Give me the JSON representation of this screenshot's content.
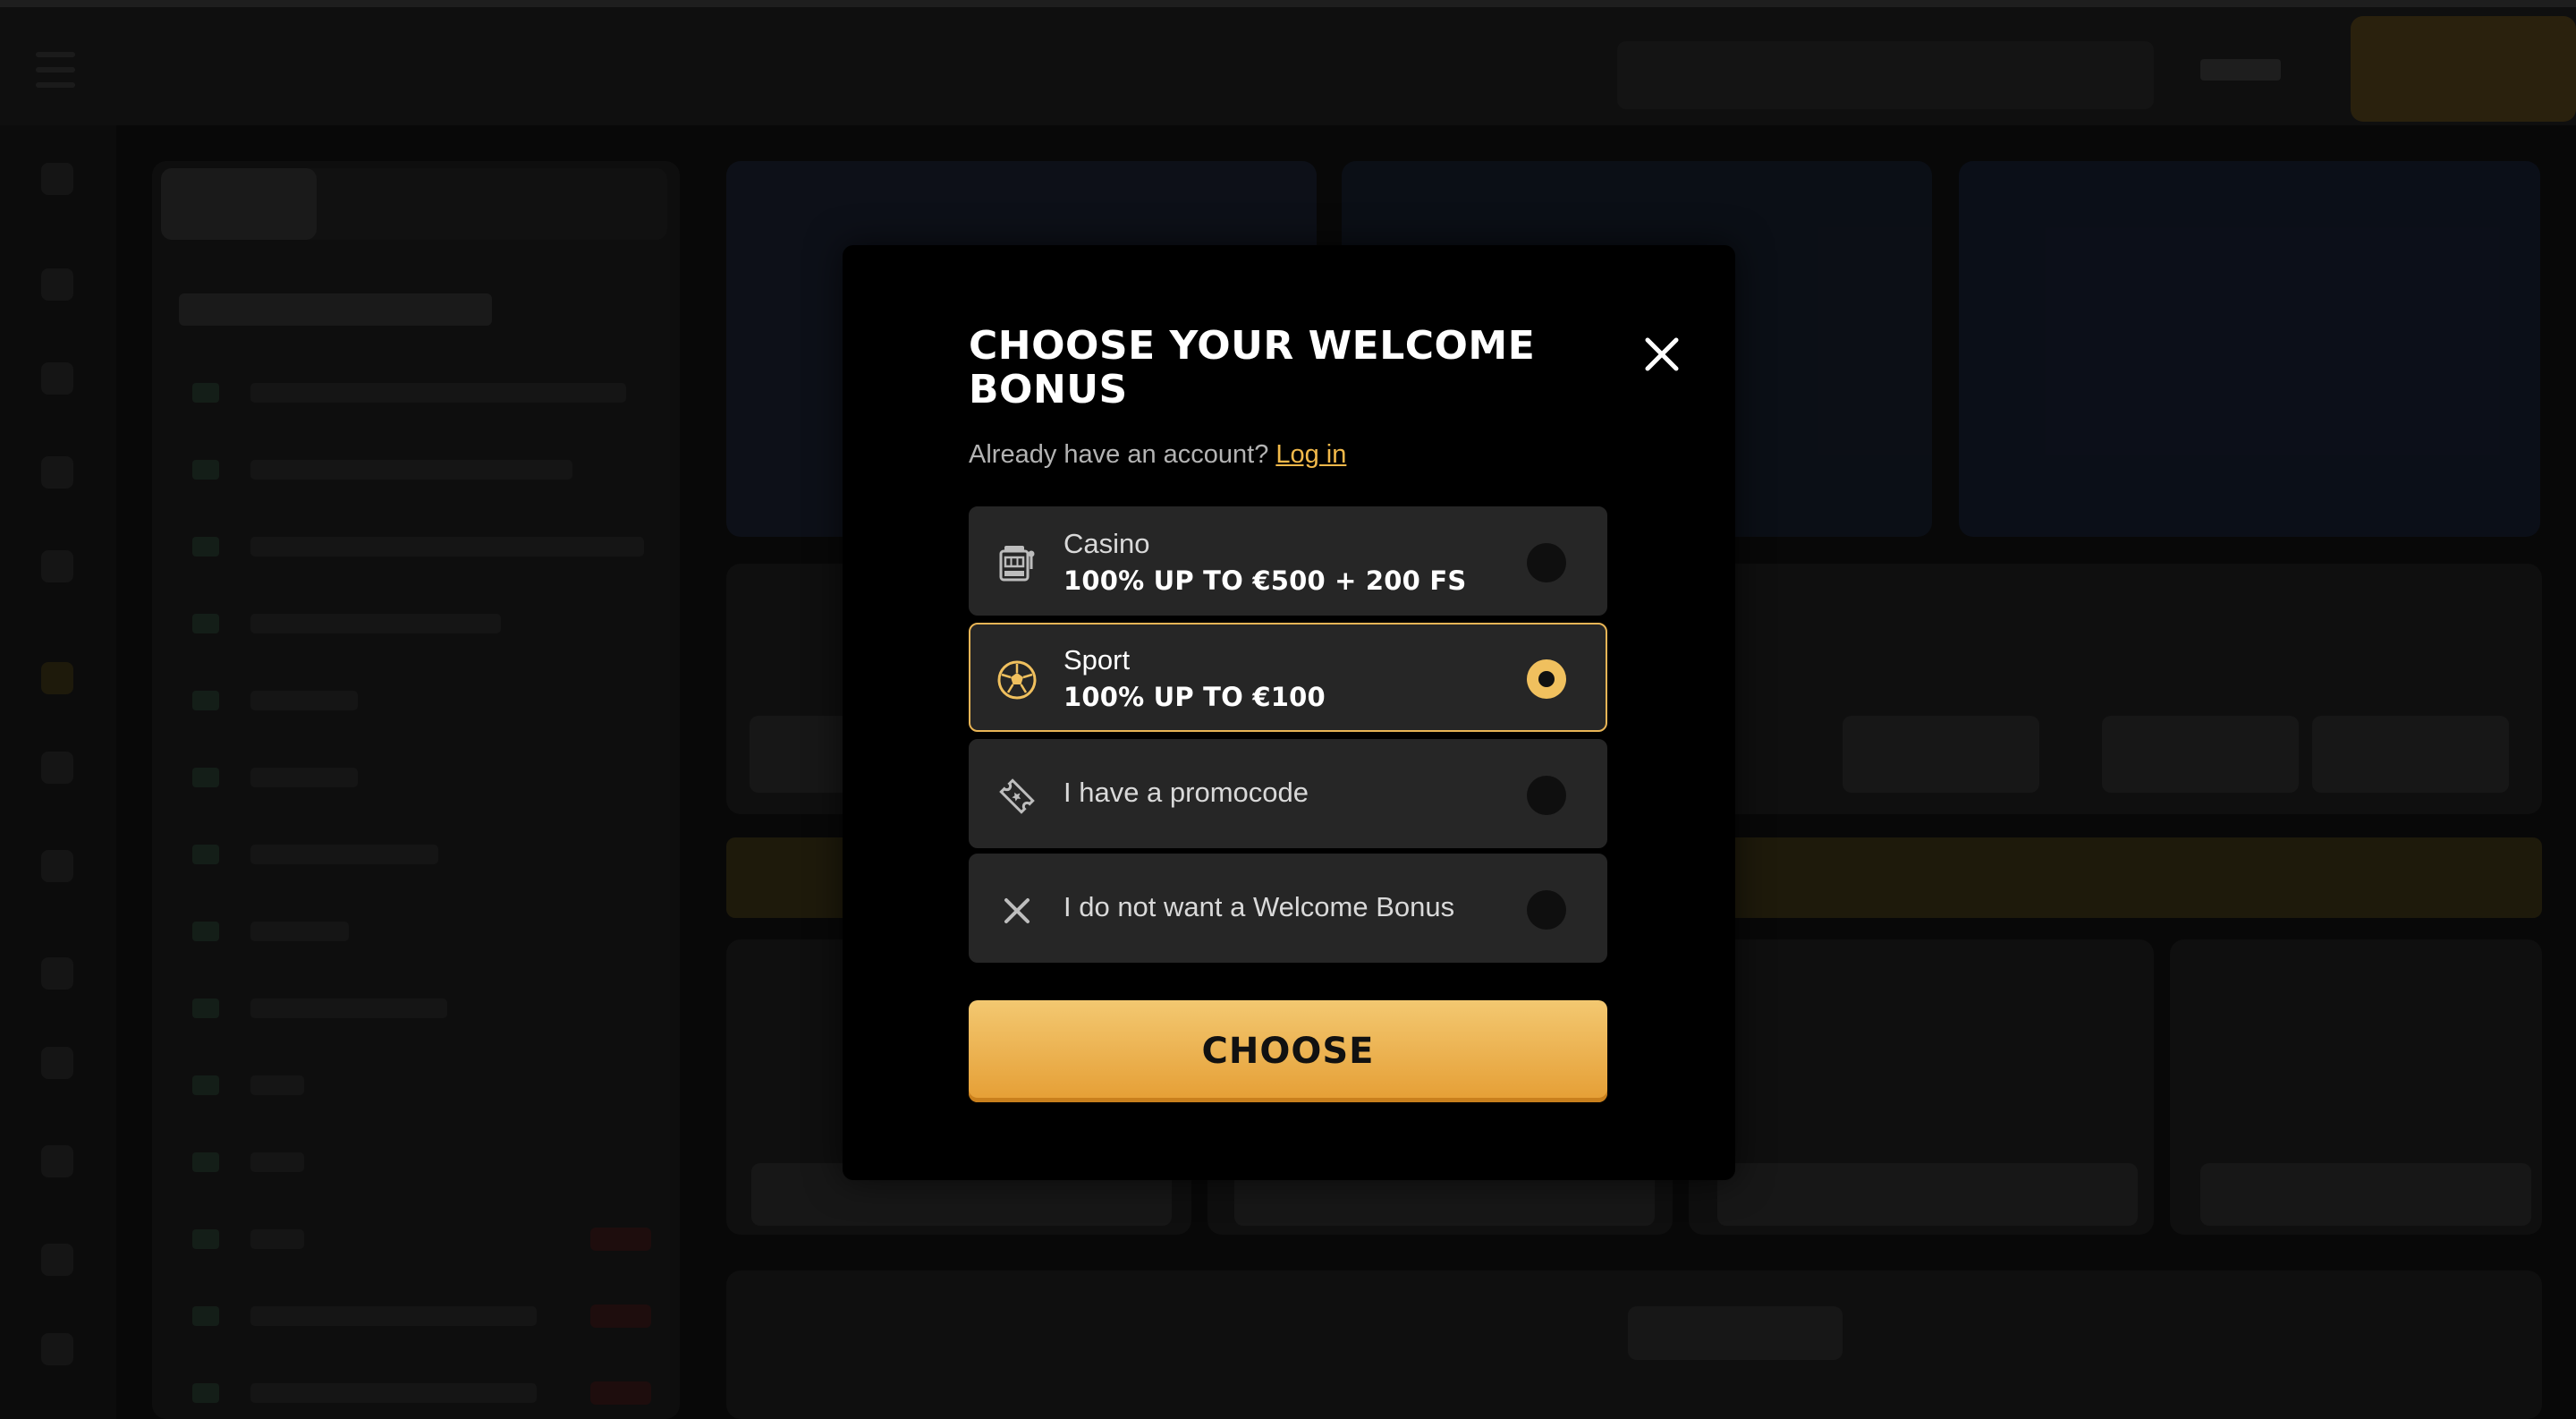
{
  "modal": {
    "title": "CHOOSE YOUR WELCOME BONUS",
    "close_icon": "close-icon",
    "account_prompt": "Already have an account?",
    "login_link": "Log in",
    "options": [
      {
        "id": "casino",
        "icon": "slot-machine-icon",
        "label": "Casino",
        "offer": "100% UP TO €500 + 200 FS",
        "selected": false
      },
      {
        "id": "sport",
        "icon": "soccer-ball-icon",
        "label": "Sport",
        "offer": "100% UP TO €100",
        "selected": true
      },
      {
        "id": "promo",
        "icon": "ticket-icon",
        "label": "I have a promocode",
        "selected": false
      },
      {
        "id": "none",
        "icon": "close-icon",
        "label": "I do not want a Welcome Bonus",
        "selected": false
      }
    ],
    "choose_button": "CHOOSE"
  },
  "colors": {
    "accent": "#f0c05e",
    "modal_bg": "#000000",
    "option_bg": "#262626"
  }
}
